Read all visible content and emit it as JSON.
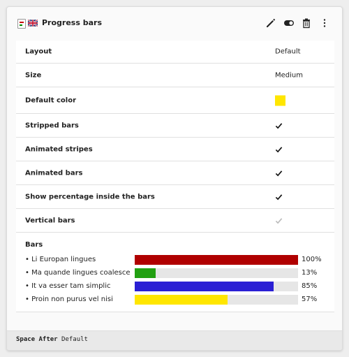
{
  "header": {
    "title": "Progress bars",
    "content_icon": "progress-bars-icon",
    "language_icon": "uk-flag-icon",
    "actions": [
      "edit-icon",
      "toggle-icon",
      "delete-icon",
      "more-icon"
    ]
  },
  "properties": [
    {
      "label": "Layout",
      "value": "Default"
    },
    {
      "label": "Size",
      "value": "Medium"
    },
    {
      "label": "Default color",
      "value": "",
      "swatch": "#ffe600"
    },
    {
      "label": "Stripped bars",
      "checked": true
    },
    {
      "label": "Animated stripes",
      "checked": true
    },
    {
      "label": "Animated bars",
      "checked": true
    },
    {
      "label": "Show percentage inside the bars",
      "checked": true
    },
    {
      "label": "Vertical bars",
      "checked": false
    }
  ],
  "bars": {
    "title": "Bars",
    "items": [
      {
        "label": "Li Europan lingues",
        "percent": 100,
        "percent_text": "100%",
        "color": "#b00000"
      },
      {
        "label": "Ma quande lingues coalesce",
        "percent": 13,
        "percent_text": "13%",
        "color": "#22a012"
      },
      {
        "label": "It va esser tam simplic",
        "percent": 85,
        "percent_text": "85%",
        "color": "#2a1fd4"
      },
      {
        "label": "Proin non purus vel nisi",
        "percent": 57,
        "percent_text": "57%",
        "color": "#ffe600"
      }
    ]
  },
  "footer": {
    "key": "Space After",
    "value": "Default"
  },
  "colors": {
    "check_active": "#111111",
    "check_inactive": "#bbbbbb"
  }
}
